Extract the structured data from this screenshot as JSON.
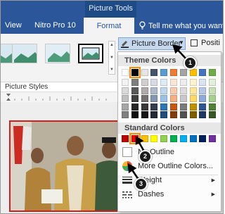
{
  "ribbon": {
    "context_label": "Picture Tools",
    "tabs": [
      {
        "label": "View"
      },
      {
        "label": "Nitro Pro 10"
      },
      {
        "label": "Format"
      }
    ],
    "tell_me": "Tell me what you want"
  },
  "picture_border_button": {
    "label": "Picture Border"
  },
  "position_button": {
    "label": "Positi"
  },
  "picture_styles_label": "Picture Styles",
  "dropdown": {
    "theme_colors_label": "Theme Colors",
    "standard_colors_label": "Standard Colors",
    "no_outline_label": "No Outline",
    "more_colors_label": "More Outline Colors...",
    "weight_label": "Weight",
    "dashes_label": "Dashes"
  },
  "theme_colors": {
    "top_row": [
      "#ffffff",
      "#000000",
      "#e7e6e6",
      "#44546a",
      "#5b9bd5",
      "#ed7d31",
      "#a5a5a5",
      "#ffc000",
      "#4472c4",
      "#70ad47"
    ],
    "shade_columns": [
      [
        "#f2f2f2",
        "#d9d9d9",
        "#bfbfbf",
        "#a6a6a6",
        "#808080"
      ],
      [
        "#7f7f7f",
        "#595959",
        "#404040",
        "#262626",
        "#0d0d0d"
      ],
      [
        "#d0cece",
        "#afabab",
        "#757171",
        "#3a3838",
        "#171616"
      ],
      [
        "#d6dce4",
        "#adb9ca",
        "#8496b0",
        "#333f4f",
        "#222a35"
      ],
      [
        "#ddebf7",
        "#bdd7ee",
        "#9bc2e6",
        "#2e75b6",
        "#1f4e79"
      ],
      [
        "#fbe5d6",
        "#f8cbad",
        "#f4b183",
        "#c55a11",
        "#843c0c"
      ],
      [
        "#ededed",
        "#dbdbdb",
        "#c9c9c9",
        "#7b7b7b",
        "#525252"
      ],
      [
        "#fff2cc",
        "#ffe699",
        "#ffd966",
        "#bf9000",
        "#7f6000"
      ],
      [
        "#dae3f3",
        "#b4c7e7",
        "#8faadc",
        "#2f5597",
        "#203864"
      ],
      [
        "#e2f0d9",
        "#c5e0b4",
        "#a9d18e",
        "#548235",
        "#385723"
      ]
    ],
    "selected": "#000000"
  },
  "standard_colors": [
    "#c00000",
    "#ff0000",
    "#ffc000",
    "#ffff00",
    "#92d050",
    "#00b050",
    "#00b0f0",
    "#0070c0",
    "#002060",
    "#7030a0"
  ],
  "selected_standard": "#ff0000",
  "callouts": [
    "1",
    "2",
    "3"
  ],
  "accent": "#2b579a",
  "picture_border_color": "#d4201b",
  "icons": [
    "pencil-icon",
    "lightbulb-icon",
    "position-icon",
    "no-outline-icon",
    "palette-icon",
    "weight-icon",
    "dashes-icon"
  ]
}
